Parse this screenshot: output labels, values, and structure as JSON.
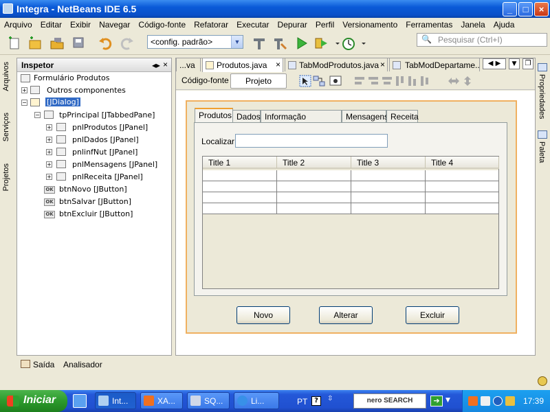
{
  "window": {
    "title": "Integra - NetBeans IDE 6.5"
  },
  "menu": [
    "Arquivo",
    "Editar",
    "Exibir",
    "Navegar",
    "Código-fonte",
    "Refatorar",
    "Executar",
    "Depurar",
    "Perfil",
    "Versionamento",
    "Ferramentas",
    "Janela",
    "Ajuda"
  ],
  "toolbar": {
    "config": "<config. padrão>",
    "search_placeholder": "Pesquisar (Ctrl+I)"
  },
  "left_tabs": [
    "Arquivos",
    "Serviços",
    "Projetos"
  ],
  "right_tabs": [
    "Propriedades",
    "Paleta"
  ],
  "inspector": {
    "title": "Inspetor",
    "nodes": [
      "Formulário Produtos",
      "Outros componentes",
      "[JDialog]",
      "tpPrincipal [JTabbedPane]",
      "pnlProdutos [JPanel]",
      "pnlDados [JPanel]",
      "pnlinfNut [JPanel]",
      "pnlMensagens [JPanel]",
      "pnlReceita [JPanel]",
      "btnNovo [JButton]",
      "btnSalvar [JButton]",
      "btnExcluir [JButton]"
    ]
  },
  "editor": {
    "tabs": [
      "...va",
      "Produtos.java",
      "TabModProdutos.java",
      "TabModDepartame..."
    ],
    "subtabs": [
      "Código-fonte",
      "Projeto"
    ]
  },
  "form": {
    "tabs": [
      "Produtos",
      "Dados",
      "Informação Nutricional",
      "Mensagens",
      "Receita"
    ],
    "search_label": "Localizar:",
    "columns": [
      "Title 1",
      "Title 2",
      "Title 3",
      "Title 4"
    ],
    "buttons": [
      "Novo",
      "Alterar",
      "Excluir"
    ]
  },
  "bottom": {
    "output": "Saída",
    "analyzer": "Analisador"
  },
  "taskbar": {
    "start": "Iniciar",
    "tasks": [
      "Int...",
      "XA...",
      "SQ...",
      "Li..."
    ],
    "lang": "PT",
    "nero": "nero SEARCH",
    "clock": "17:39"
  }
}
